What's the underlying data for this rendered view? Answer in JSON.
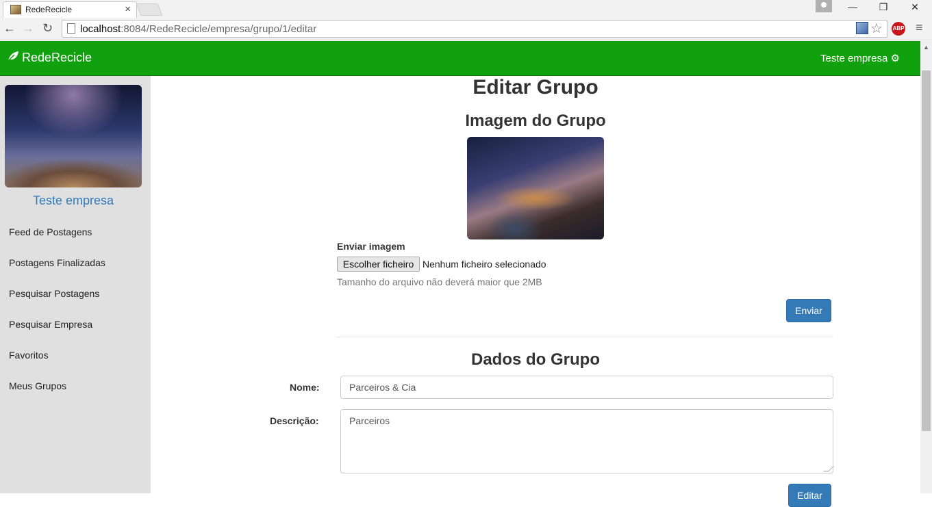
{
  "browser": {
    "tab_title": "RedeRecicle",
    "tab_close": "×",
    "url_host": "localhost",
    "url_path": ":8084/RedeRecicle/empresa/grupo/1/editar",
    "back": "←",
    "forward": "→",
    "reload": "↻",
    "star": "☆",
    "abp": "ABP",
    "menu": "≡",
    "minimize": "—",
    "restore": "❐",
    "close": "✕"
  },
  "navbar": {
    "brand_icon": "leaf-icon",
    "brand": "RedeRecicle",
    "user": "Teste empresa",
    "user_icon": "gear-icon"
  },
  "sidebar": {
    "profile_name": "Teste empresa",
    "items": [
      {
        "label": "Feed de Postagens"
      },
      {
        "label": "Postagens Finalizadas"
      },
      {
        "label": "Pesquisar Postagens"
      },
      {
        "label": "Pesquisar Empresa"
      },
      {
        "label": "Favoritos"
      },
      {
        "label": "Meus Grupos"
      }
    ]
  },
  "main": {
    "title": "Editar Grupo",
    "image_section": {
      "title": "Imagem do Grupo",
      "upload_label": "Enviar imagem",
      "file_button": "Escolher ficheiro",
      "file_status": "Nenhum ficheiro selecionado",
      "help": "Tamanho do arquivo não deverá maior que 2MB",
      "submit": "Enviar"
    },
    "data_section": {
      "title": "Dados do Grupo",
      "name_label": "Nome:",
      "name_value": "Parceiros & Cia",
      "description_label": "Descrição:",
      "description_value": "Parceiros",
      "submit": "Editar"
    }
  },
  "colors": {
    "navbar": "#11a10f",
    "primary": "#337ab7",
    "sidebar": "#e0e0e0"
  }
}
